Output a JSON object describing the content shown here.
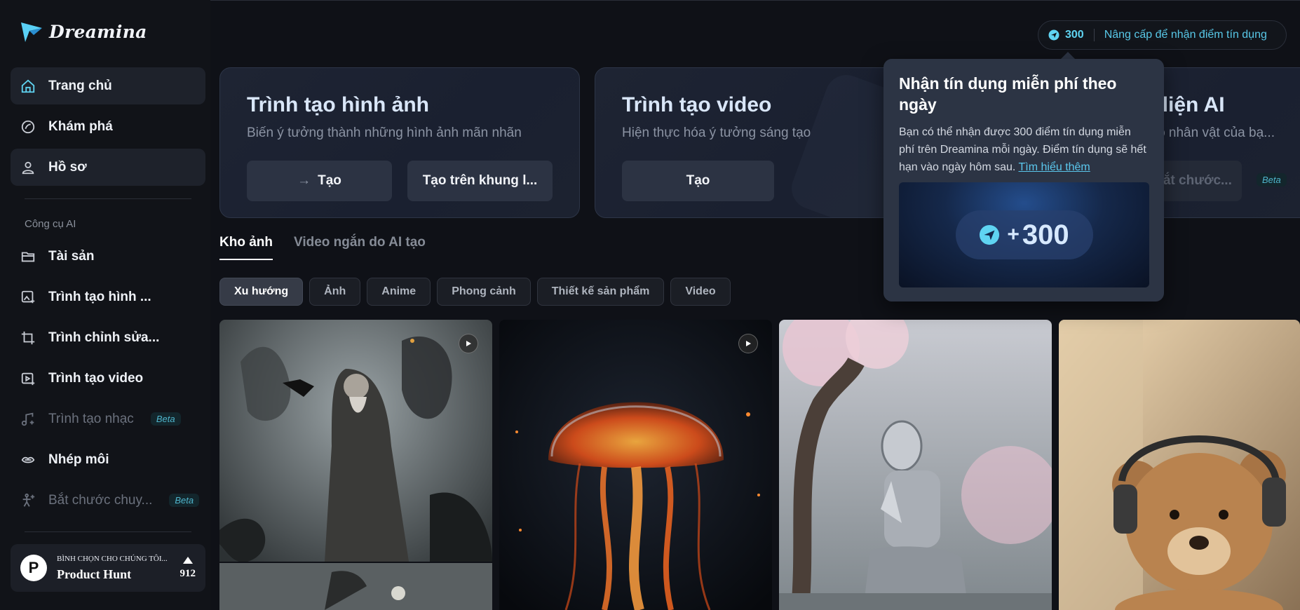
{
  "app": {
    "logo_text": "Dreamina"
  },
  "sidebar": {
    "items": [
      {
        "label": "Trang chủ",
        "icon": "home-icon"
      },
      {
        "label": "Khám phá",
        "icon": "explore-icon"
      },
      {
        "label": "Hồ sơ",
        "icon": "user-icon"
      }
    ],
    "section_label": "Công cụ AI",
    "tools": [
      {
        "label": "Tài sản",
        "icon": "folder-icon"
      },
      {
        "label": "Trình tạo hình ...",
        "icon": "image-gen-icon"
      },
      {
        "label": "Trình chỉnh sửa...",
        "icon": "crop-icon"
      },
      {
        "label": "Trình tạo video",
        "icon": "video-gen-icon"
      },
      {
        "label": "Trình tạo nhạc",
        "icon": "music-icon",
        "badge": "Beta"
      },
      {
        "label": "Nhép môi",
        "icon": "lip-sync-icon"
      },
      {
        "label": "Bắt chước chuy...",
        "icon": "motion-icon",
        "badge": "Beta"
      }
    ],
    "product_hunt": {
      "small": "BÌNH CHỌN CHO CHÚNG TÔI...",
      "name": "Product Hunt",
      "count": "912",
      "logo_letter": "P"
    }
  },
  "header": {
    "credits": "300",
    "upgrade_label": "Nâng cấp để nhận điểm tín dụng"
  },
  "cards": [
    {
      "title": "Trình tạo hình ảnh",
      "subtitle": "Biến ý tưởng thành những hình ảnh mãn nhãn",
      "btn1": "Tạo",
      "btn2": "Tạo trên khung l..."
    },
    {
      "title": "Trình tạo video",
      "subtitle": "Hiện thực hóa ý tưởng sáng tạo",
      "btn1": "Tạo"
    },
    {
      "title": "i diện AI",
      "subtitle": "cho nhân vật của bạ...",
      "btn1": "Bắt chước...",
      "badge": "Beta"
    }
  ],
  "tabs": [
    "Kho ảnh",
    "Video ngắn do AI tạo"
  ],
  "chips": [
    "Xu hướng",
    "Ảnh",
    "Anime",
    "Phong cảnh",
    "Thiết kế sản phẩm",
    "Video"
  ],
  "popover": {
    "title": "Nhận tín dụng miễn phí theo ngày",
    "body": "Bạn có thể nhận được 300 điểm tín dụng miễn phí trên Dreamina mỗi ngày. Điểm tín dụng sẽ hết hạn vào ngày hôm sau.",
    "link": "Tìm hiểu thêm",
    "banner_plus": "+",
    "banner_value": "300"
  },
  "colors": {
    "accent": "#5fd4f2",
    "background": "#0f1117",
    "popover": "#2c3444"
  }
}
